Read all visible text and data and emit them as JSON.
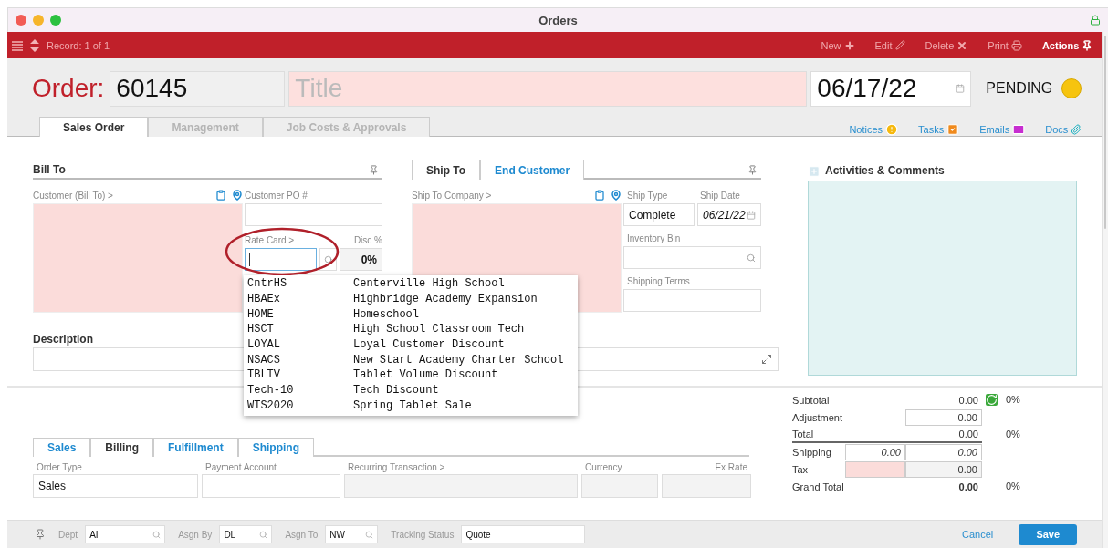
{
  "window": {
    "title": "Orders"
  },
  "toolbar": {
    "record": "Record: 1 of 1",
    "actions": [
      {
        "label": "New",
        "kind": "plus",
        "disabled": true
      },
      {
        "label": "Edit",
        "kind": "pencil",
        "disabled": true
      },
      {
        "label": "Delete",
        "kind": "x",
        "disabled": true
      },
      {
        "label": "Print",
        "kind": "printer",
        "disabled": true
      },
      {
        "label": "Actions",
        "kind": "pin",
        "disabled": false
      }
    ]
  },
  "header": {
    "label": "Order:",
    "number": "60145",
    "title_placeholder": "Title",
    "date": "06/17/22",
    "status": "PENDING"
  },
  "tabs": [
    {
      "label": "Sales Order",
      "selected": true
    },
    {
      "label": "Management",
      "selected": false
    },
    {
      "label": "Job Costs & Approvals",
      "selected": false
    }
  ],
  "links": [
    {
      "label": "Notices",
      "kind": "notice"
    },
    {
      "label": "Tasks",
      "kind": "task"
    },
    {
      "label": "Emails",
      "kind": "email"
    },
    {
      "label": "Docs",
      "kind": "attachment"
    }
  ],
  "bill_to": {
    "title": "Bill To",
    "customer_label": "Customer (Bill To) >",
    "po_label": "Customer PO #",
    "rate_card_label": "Rate Card >",
    "disc_label": "Disc %",
    "disc_value": "0%"
  },
  "ship_to": {
    "tabs": [
      {
        "label": "Ship To",
        "selected": true
      },
      {
        "label": "End Customer",
        "selected": false
      }
    ],
    "company_label": "Ship To Company >",
    "ship_type_label": "Ship Type",
    "ship_type": "Complete",
    "ship_date_label": "Ship Date",
    "ship_date": "06/21/22",
    "bin_label": "Inventory Bin",
    "terms_label": "Shipping Terms"
  },
  "description": {
    "label": "Description"
  },
  "activities": {
    "title": "Activities & Comments"
  },
  "rate_card_options": [
    {
      "code": "CntrHS",
      "name": "Centerville High School"
    },
    {
      "code": "HBAEx",
      "name": "Highbridge Academy Expansion"
    },
    {
      "code": "HOME",
      "name": "Homeschool"
    },
    {
      "code": "HSCT",
      "name": "High School Classroom Tech"
    },
    {
      "code": "LOYAL",
      "name": "Loyal Customer Discount"
    },
    {
      "code": "NSACS",
      "name": "New Start Academy Charter School"
    },
    {
      "code": "TBLTV",
      "name": "Tablet Volume Discount"
    },
    {
      "code": "Tech-10",
      "name": "Tech Discount"
    },
    {
      "code": "WTS2020",
      "name": "Spring Tablet Sale"
    }
  ],
  "detail_tabs": [
    {
      "label": "Sales",
      "selected": false
    },
    {
      "label": "Billing",
      "selected": true
    },
    {
      "label": "Fulfillment",
      "selected": false
    },
    {
      "label": "Shipping",
      "selected": false
    }
  ],
  "billing_fields": [
    {
      "label": "Order Type",
      "value": "Sales",
      "disabled": false
    },
    {
      "label": "Payment Account",
      "disabled": false
    },
    {
      "label": "Recurring Transaction >",
      "disabled": true
    },
    {
      "label": "Currency",
      "disabled": true
    },
    {
      "label": "Ex Rate",
      "disabled": true
    }
  ],
  "totals": [
    {
      "kind": "subtotal",
      "label": "Subtotal",
      "values": [
        "0.00"
      ],
      "percent": "0%"
    },
    {
      "kind": "input",
      "label": "Adjustment",
      "values": [
        "0.00"
      ]
    },
    {
      "kind": "total",
      "label": "Total",
      "values": [
        "0.00"
      ],
      "percent": "0%"
    },
    {
      "kind": "pair",
      "label": "Shipping",
      "values": [
        "0.00",
        "0.00"
      ]
    },
    {
      "kind": "tax",
      "label": "Tax",
      "values": [
        "0.00"
      ]
    },
    {
      "kind": "grand",
      "label": "Grand Total",
      "values": [
        "0.00"
      ],
      "percent": "0%"
    }
  ],
  "footer": {
    "fields": [
      {
        "label": "Dept",
        "value": "AI"
      },
      {
        "label": "Asgn By",
        "value": "DL"
      },
      {
        "label": "Asgn To",
        "value": "NW"
      },
      {
        "label": "Tracking Status",
        "value": "Quote"
      }
    ],
    "cancel": "Cancel",
    "save": "Save"
  }
}
